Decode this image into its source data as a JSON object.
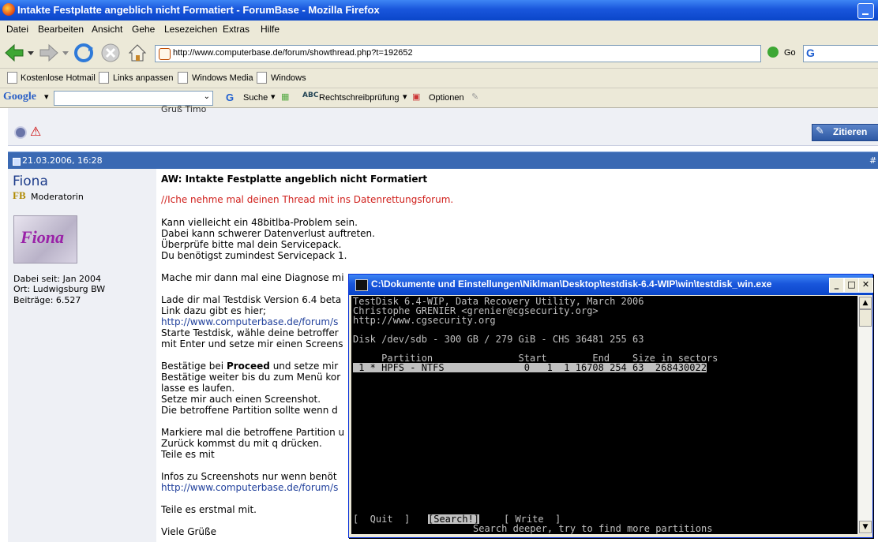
{
  "window": {
    "title": "Intakte Festplatte angeblich nicht Formatiert - ForumBase - Mozilla Firefox"
  },
  "menubar": [
    "Datei",
    "Bearbeiten",
    "Ansicht",
    "Gehe",
    "Lesezeichen",
    "Extras",
    "Hilfe"
  ],
  "navbar": {
    "url": "http://www.computerbase.de/forum/showthread.php?t=192652",
    "go_label": "Go"
  },
  "bookmarks": [
    "Kostenlose Hotmail",
    "Links anpassen",
    "Windows Media",
    "Windows"
  ],
  "google_toolbar": {
    "logo": "Google",
    "search_label": "Suche",
    "spell_label": "Rechtschreibprüfung",
    "options_label": "Optionen"
  },
  "forum": {
    "prev_post_snippet": "Gruß Timo",
    "quote_button": "Zitieren",
    "post": {
      "date": "21.03.2006, 16:28",
      "number": "#",
      "user": {
        "name": "Fiona",
        "rank": "Moderatorin",
        "avatar_text": "Fiona",
        "since": "Dabei seit: Jan 2004",
        "location": "Ort: Ludwigsburg BW",
        "posts": "Beiträge: 6.527"
      },
      "title": "AW: Intakte Festplatte angeblich nicht Formatiert",
      "red_line": "//Iche nehme mal deinen Thread mit ins Datenrettungsforum.",
      "lines": [
        "Kann vielleicht ein 48bitlba-Problem sein.",
        "Dabei kann schwerer Datenverlust auftreten.",
        "Überprüfe bitte mal dein Servicepack.",
        "Du benötigst zumindest Servicepack 1.",
        "Mache mir dann mal eine Diagnose mi",
        "Lade dir mal Testdisk Version 6.4 beta",
        "Link dazu gibt es hier;",
        "http://www.computerbase.de/forum/s",
        "Starte Testdisk, wähle deine betroffer",
        "mit Enter und setze mir einen Screens",
        "Bestätige bei ",
        "Proceed",
        " und setze mir",
        "Bestätige weiter bis du zum Menü kor",
        "lasse es laufen.",
        "Setze mir auch einen Screenshot.",
        "Die betroffene Partition sollte wenn d",
        "Markiere mal die betroffene Partition u",
        "Zurück kommst du mit q drücken.",
        "Teile es mit",
        "Infos zu Screenshots nur wenn benöt",
        "http://www.computerbase.de/forum/s",
        "Teile es erstmal mit.",
        "Viele Grüße"
      ]
    }
  },
  "console": {
    "title": "C:\\Dokumente und Einstellungen\\Niklman\\Desktop\\testdisk-6.4-WIP\\win\\testdisk_win.exe",
    "lines": [
      "TestDisk 6.4-WIP, Data Recovery Utility, March 2006",
      "Christophe GRENIER <grenier@cgsecurity.org>",
      "http://www.cgsecurity.org",
      "",
      "Disk /dev/sdb - 300 GB / 279 GiB - CHS 36481 255 63",
      "",
      "     Partition               Start        End    Size in sectors"
    ],
    "selected_row": " 1 * HPFS - NTFS              0   1  1 16708 254 63  268430022",
    "menu_quit": "[  Quit  ]",
    "menu_search": "[Search!]",
    "menu_write": "[ Write  ]",
    "hint": "Search deeper, try to find more partitions"
  },
  "colors": {
    "titlebar": "#1956dc",
    "post_header": "#3a69b3",
    "link": "#1f3f9b",
    "red": "#d0211d"
  }
}
